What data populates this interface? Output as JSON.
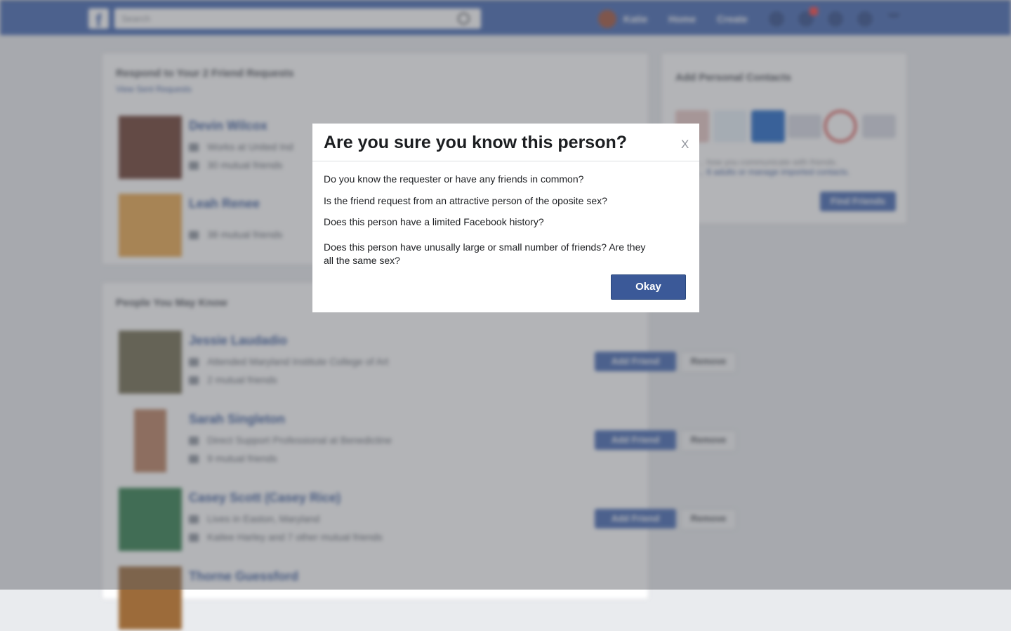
{
  "topbar": {
    "logo": "f",
    "search_placeholder": "Search",
    "user_name": "Katie",
    "nav_links": [
      "Home",
      "Create"
    ]
  },
  "requests": {
    "title": "Respond to Your 2 Friend Requests",
    "view_sent": "View Sent Requests",
    "items": [
      {
        "name": "Devin Wilcox",
        "line1": "Works at United Ind",
        "line2": "30 mutual friends"
      },
      {
        "name": "Leah Renee",
        "line1": "38 mutual friends",
        "line2": ""
      }
    ]
  },
  "pymk": {
    "title": "People You May Know",
    "add_label": "Add Friend",
    "remove_label": "Remove",
    "items": [
      {
        "name": "Jessie Laudadio",
        "line1": "Attended Maryland Institute College of Art",
        "line2": "2 mutual friends"
      },
      {
        "name": "Sarah Singleton",
        "line1": "Direct Support Professional at Benedictine",
        "line2": "9 mutual friends"
      },
      {
        "name": "Casey Scott (Casey Rice)",
        "line1": "Lives in Easton, Maryland",
        "line2": "Kailee Harley and 7 other mutual friends"
      },
      {
        "name": "Thorne Guessford",
        "line1": "",
        "line2": ""
      }
    ]
  },
  "contacts": {
    "title": "Add Personal Contacts",
    "desc_line1": "... how you communicate with friends.",
    "desc_line2": "... 6 adults or manage imported contacts.",
    "find_label": "Find Friends"
  },
  "modal": {
    "title": "Are you sure you know this person?",
    "close": "X",
    "questions": [
      "Do you know the requester or have any friends in common?",
      "Is the friend request from an attractive person of the oposite sex?",
      "Does this person have a limited Facebook history?",
      "Does this person have unusally large or small number of friends? Are they all the same sex?"
    ],
    "okay_label": "Okay"
  }
}
